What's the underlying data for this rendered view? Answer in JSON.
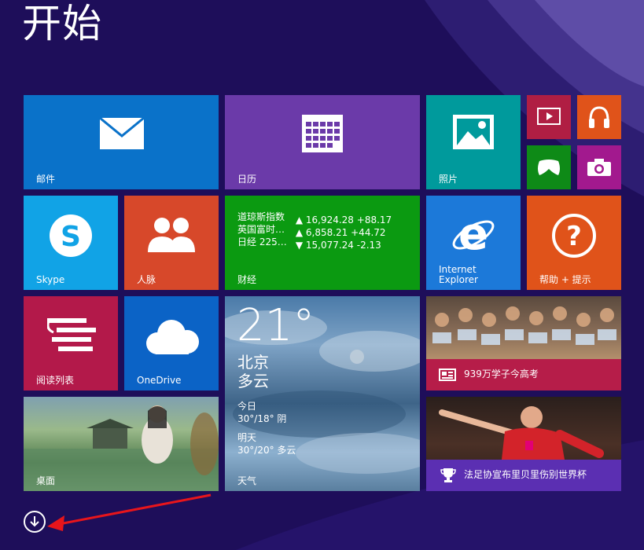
{
  "screen": {
    "title": "开始"
  },
  "tiles": {
    "mail": {
      "label": "邮件",
      "icon": "mail-icon",
      "color": "#0a72c9"
    },
    "calendar": {
      "label": "日历",
      "icon": "calendar-icon",
      "color": "#6b3aa9"
    },
    "photos": {
      "label": "照片",
      "icon": "photos-icon",
      "color": "#009a9c"
    },
    "video": {
      "icon": "video-icon",
      "color": "#b01e43"
    },
    "music": {
      "icon": "headphones-icon",
      "color": "#e0531a"
    },
    "games": {
      "icon": "xbox-controller-icon",
      "color": "#0e8a17"
    },
    "camera": {
      "icon": "camera-icon",
      "color": "#a2198e"
    },
    "skype": {
      "label": "Skype",
      "icon": "skype-icon",
      "color": "#11a3e6"
    },
    "people": {
      "label": "人脉",
      "icon": "people-icon",
      "color": "#d7482a"
    },
    "finance": {
      "label": "财经",
      "color": "#0b9a11",
      "rows": [
        {
          "name": "道琼斯指数",
          "value": "▲ 16,924.28 +88.17"
        },
        {
          "name": "英国富时…",
          "value": "▲ 6,858.21 +44.72"
        },
        {
          "name": "日经 225…",
          "value": "▼ 15,077.24 -2.13"
        }
      ]
    },
    "ie": {
      "label_line1": "Internet",
      "label_line2": "Explorer",
      "icon": "internet-explorer-icon",
      "color": "#1c79d9"
    },
    "help": {
      "label": "帮助 + 提示",
      "icon": "help-icon",
      "color": "#e0531a"
    },
    "reading": {
      "label": "阅读列表",
      "icon": "reading-list-icon",
      "color": "#b3194a"
    },
    "onedrive": {
      "label": "OneDrive",
      "icon": "cloud-icon",
      "color": "#0b63c6"
    },
    "weather": {
      "temp": "21°",
      "city": "北京",
      "condition": "多云",
      "today_label": "今日",
      "today_forecast": "30°/18° 阴",
      "tomorrow_label": "明天",
      "tomorrow_forecast": "30°/20° 多云",
      "label": "天气"
    },
    "news": {
      "headline": "939万学子今高考",
      "icon": "news-icon",
      "bar_color": "#b61d49"
    },
    "desktop": {
      "label": "桌面"
    },
    "sports": {
      "headline": "法足协宣布里贝里伤别世界杯",
      "icon": "trophy-icon",
      "bar_color": "#5b2fb2"
    }
  },
  "bottom": {
    "all_apps_icon": "down-arrow-circle-icon"
  }
}
